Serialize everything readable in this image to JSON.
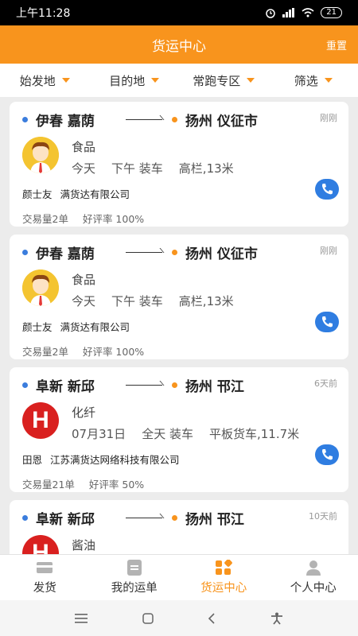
{
  "status_bar": {
    "time": "上午11:28",
    "battery": "21"
  },
  "header": {
    "title": "货运中心",
    "reset_label": "重置"
  },
  "filters": [
    {
      "label": "始发地"
    },
    {
      "label": "目的地"
    },
    {
      "label": "常跑专区"
    },
    {
      "label": "筛选"
    }
  ],
  "cards": [
    {
      "from": "伊春 嘉荫",
      "to": "扬州 仪征市",
      "time_ago": "刚刚",
      "avatar": "person-avatar",
      "goods": "食品",
      "date": "今天",
      "period": "下午 装车",
      "truck": "高栏,13米",
      "contact": "颜士友",
      "company": "满货达有限公司",
      "trades": "交易量2单",
      "rating": "好评率 100%"
    },
    {
      "from": "伊春 嘉荫",
      "to": "扬州 仪征市",
      "time_ago": "刚刚",
      "avatar": "person-avatar",
      "goods": "食品",
      "date": "今天",
      "period": "下午 装车",
      "truck": "高栏,13米",
      "contact": "颜士友",
      "company": "满货达有限公司",
      "trades": "交易量2单",
      "rating": "好评率 100%"
    },
    {
      "from": "阜新 新邱",
      "to": "扬州 邗江",
      "time_ago": "6天前",
      "avatar": "hospital-avatar",
      "avatar_letter": "H",
      "goods": "化纤",
      "date": "07月31日",
      "period": "全天 装车",
      "truck": "平板货车,11.7米",
      "contact": "田恩",
      "company": "江苏满货达网络科技有限公司",
      "trades": "交易量21单",
      "rating": "好评率 50%"
    },
    {
      "from": "阜新 新邱",
      "to": "扬州 邗江",
      "time_ago": "10天前",
      "avatar": "hospital-avatar",
      "avatar_letter": "H",
      "goods": "酱油"
    }
  ],
  "tabbar": [
    {
      "label": "发货",
      "icon": "wallet-icon"
    },
    {
      "label": "我的运单",
      "icon": "list-icon"
    },
    {
      "label": "货运中心",
      "icon": "grid-icon",
      "active": true
    },
    {
      "label": "个人中心",
      "icon": "person-icon"
    }
  ],
  "colors": {
    "accent": "#f8941d",
    "phone_blue": "#2f7de1"
  }
}
